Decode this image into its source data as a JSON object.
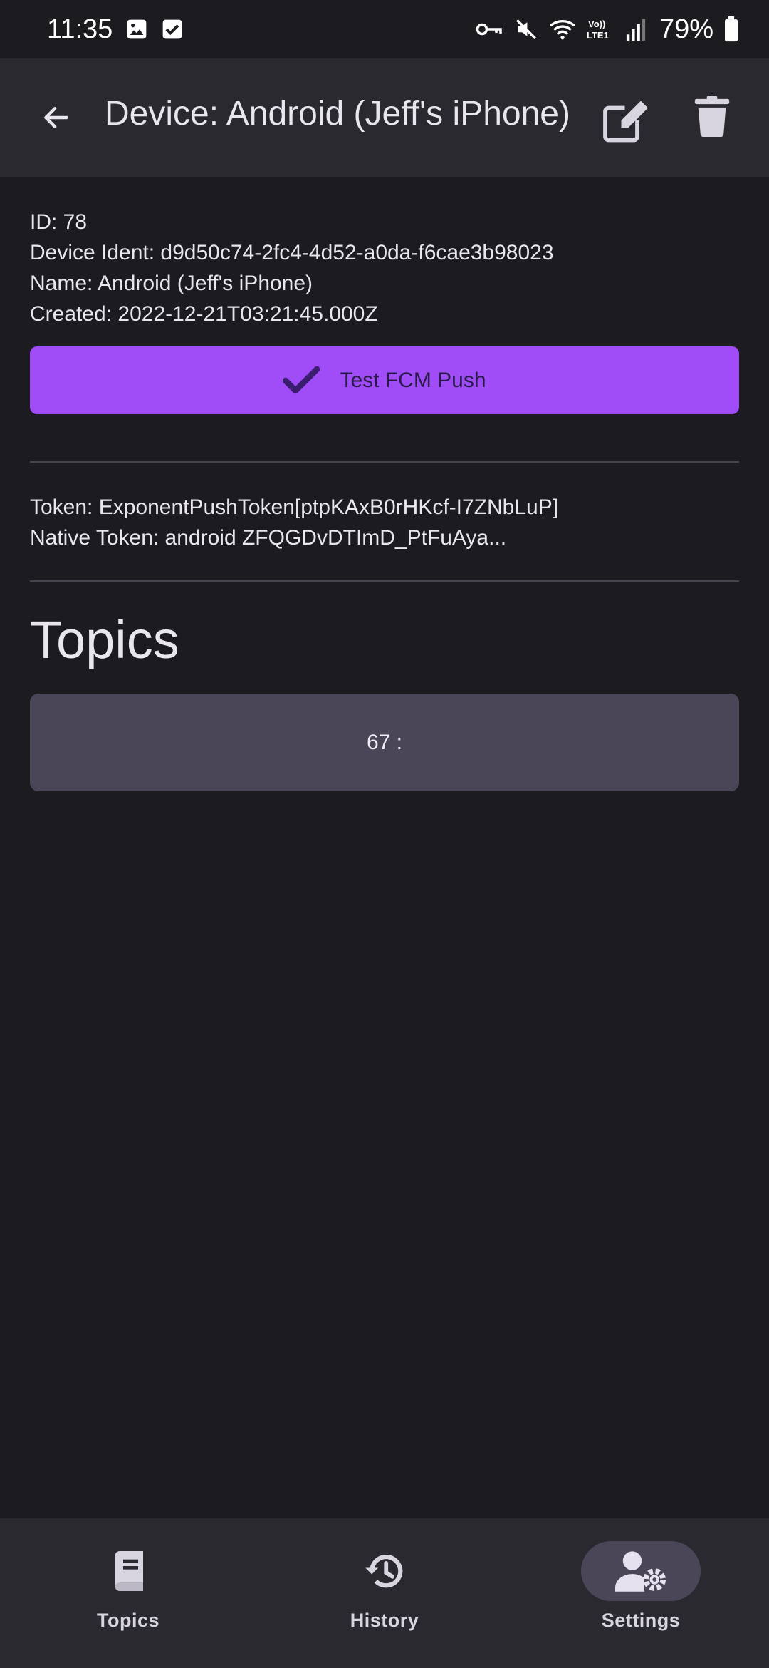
{
  "status_bar": {
    "time": "11:35",
    "battery": "79%",
    "icons": [
      "image-icon",
      "checkbox-icon",
      "vpn-key-icon",
      "mute-icon",
      "wifi-icon",
      "volte-icon",
      "signal-icon",
      "battery-icon"
    ],
    "volte_label": "Vo)) LTE1"
  },
  "app_bar": {
    "title": "Device: Android (Jeff's iPhone)",
    "icons": [
      "back-arrow-icon",
      "edit-icon",
      "trash-icon"
    ]
  },
  "device": {
    "id_line": "ID: 78",
    "ident_line": "Device Ident: d9d50c74-2fc4-4d52-a0da-f6cae3b98023",
    "name_line": "Name: Android (Jeff's iPhone)",
    "created_line": "Created: 2022-12-21T03:21:45.000Z"
  },
  "test_button": {
    "label": "Test FCM Push",
    "icon": "check-icon"
  },
  "tokens": {
    "token_line": "Token: ExponentPushToken[ptpKAxB0rHKcf-I7ZNbLuP]",
    "native_line": "Native Token: android ZFQGDvDTImD_PtFuAya..."
  },
  "topics": {
    "heading": "Topics",
    "items": [
      {
        "label": "67 :"
      }
    ]
  },
  "bottom_nav": {
    "items": [
      {
        "label": "Topics",
        "icon": "book-icon",
        "active": false
      },
      {
        "label": "History",
        "icon": "history-icon",
        "active": false
      },
      {
        "label": "Settings",
        "icon": "user-settings-icon",
        "active": true
      }
    ]
  },
  "colors": {
    "background": "#1c1b20",
    "surface": "#2b2930",
    "accent": "#a04df8",
    "card": "#4a4658"
  }
}
